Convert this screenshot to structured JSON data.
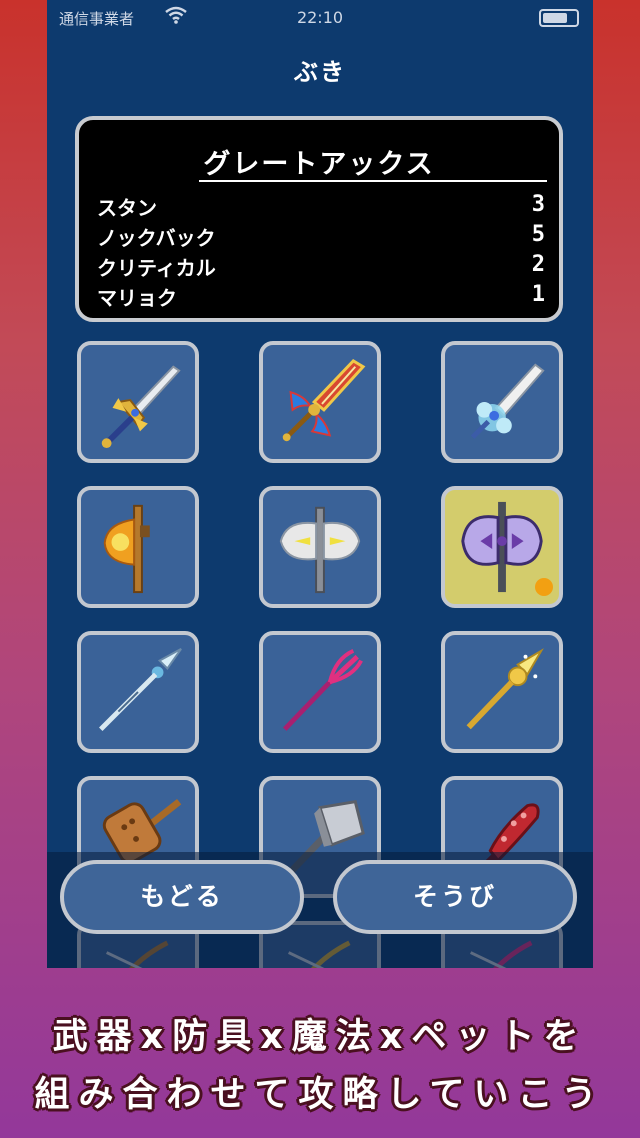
{
  "status_bar": {
    "carrier": "通信事業者",
    "time": "22:10"
  },
  "screen": {
    "title": "ぶき"
  },
  "selected_weapon": {
    "name": "グレートアックス",
    "stats": [
      {
        "label": "スタン",
        "value": "3"
      },
      {
        "label": "ノックバック",
        "value": "5"
      },
      {
        "label": "クリティカル",
        "value": "2"
      },
      {
        "label": "マリョク",
        "value": "1"
      }
    ]
  },
  "weapons": [
    {
      "icon": "royal-sword-icon",
      "selected": false,
      "equipped": false
    },
    {
      "icon": "ornate-sword-icon",
      "selected": false,
      "equipped": false
    },
    {
      "icon": "ice-sword-icon",
      "selected": false,
      "equipped": false
    },
    {
      "icon": "fire-axe-icon",
      "selected": false,
      "equipped": false
    },
    {
      "icon": "silver-battle-axe-icon",
      "selected": false,
      "equipped": false
    },
    {
      "icon": "great-axe-icon",
      "selected": true,
      "equipped": true
    },
    {
      "icon": "ice-spear-icon",
      "selected": false,
      "equipped": false
    },
    {
      "icon": "trident-icon",
      "selected": false,
      "equipped": false
    },
    {
      "icon": "golden-spear-icon",
      "selected": false,
      "equipped": false
    },
    {
      "icon": "wooden-hammer-icon",
      "selected": false,
      "equipped": false
    },
    {
      "icon": "iron-hammer-icon",
      "selected": false,
      "equipped": false
    },
    {
      "icon": "spiked-club-icon",
      "selected": false,
      "equipped": false
    },
    {
      "icon": "bow-icon",
      "selected": false,
      "equipped": false
    },
    {
      "icon": "bow-icon",
      "selected": false,
      "equipped": false
    },
    {
      "icon": "bow-icon",
      "selected": false,
      "equipped": false
    }
  ],
  "buttons": {
    "back": "もどる",
    "equip": "そうび"
  },
  "promo": {
    "line1": "武器x防具x魔法xペットを",
    "line2": "組み合わせて攻略していこう"
  },
  "colors": {
    "phone_background": "#0d3a6e",
    "cell_background": "#3a6298",
    "selected_cell": "#d3cc6c",
    "equipped_marker": "#f2a012"
  }
}
